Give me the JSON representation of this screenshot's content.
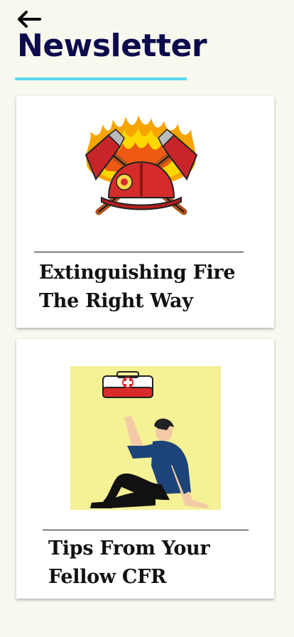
{
  "header": {
    "back_icon": "arrow-left-icon",
    "title": "Newsletter",
    "accent_color": "#58d9f2",
    "title_color": "#0c0b4c"
  },
  "articles": [
    {
      "title": "Extinguishing Fire The Right Way",
      "image": "fire-axes-helmet-illustration"
    },
    {
      "title": "Tips From Your Fellow CFR",
      "image": "first-aid-kit-person-illustration"
    }
  ]
}
